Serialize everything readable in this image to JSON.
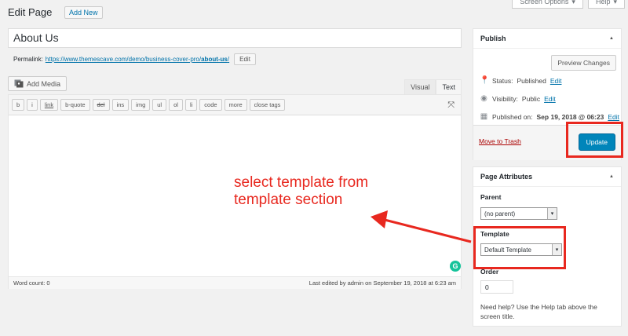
{
  "header": {
    "title": "Edit Page",
    "add_new_label": "Add New",
    "screen_options_label": "Screen Options",
    "help_label": "Help"
  },
  "post": {
    "title": "About Us",
    "permalink_label": "Permalink:",
    "permalink_base": "https://www.themescave.com/demo/business-cover-pro/",
    "permalink_slug": "about-us",
    "permalink_trailing": "/",
    "edit_label": "Edit"
  },
  "editor": {
    "add_media_label": "Add Media",
    "visual_tab": "Visual",
    "text_tab": "Text",
    "quicktags": [
      "b",
      "i",
      "link",
      "b-quote",
      "del",
      "ins",
      "img",
      "ul",
      "ol",
      "li",
      "code",
      "more",
      "close tags"
    ],
    "word_count": "Word count: 0",
    "last_edited": "Last edited by admin on September 19, 2018 at 6:23 am"
  },
  "publish": {
    "heading": "Publish",
    "preview_label": "Preview Changes",
    "status_label": "Status:",
    "status_value": "Published",
    "visibility_label": "Visibility:",
    "visibility_value": "Public",
    "published_label": "Published on:",
    "published_value": "Sep 19, 2018 @ 06:23",
    "edit_label": "Edit",
    "trash_label": "Move to Trash",
    "update_label": "Update"
  },
  "page_attributes": {
    "heading": "Page Attributes",
    "parent_label": "Parent",
    "parent_value": "(no parent)",
    "template_label": "Template",
    "template_value": "Default Template",
    "order_label": "Order",
    "order_value": "0",
    "help_text": "Need help? Use the Help tab above the screen title."
  },
  "annotation": {
    "line1": "select template from",
    "line2": "template section",
    "color": "#e8281f"
  },
  "colors": {
    "link": "#0073aa",
    "primary_button": "#0085ba",
    "trash": "#a00"
  }
}
